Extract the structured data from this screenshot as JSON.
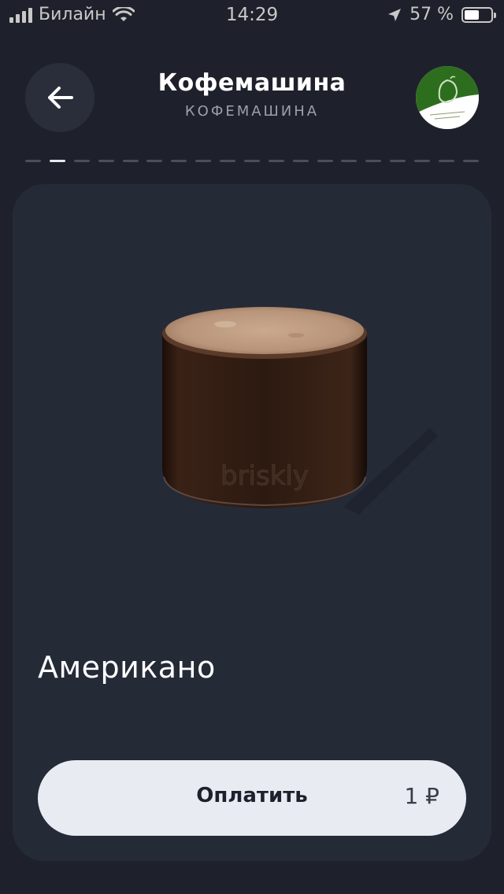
{
  "status_bar": {
    "carrier": "Билайн",
    "time": "14:29",
    "battery": "57 %",
    "battery_level": 0.57
  },
  "header": {
    "title": "Кофемашина",
    "subtitle": "КОФЕМАШИНА",
    "back_icon": "arrow-left-icon",
    "logo_icon": "cafe-logo"
  },
  "pager": {
    "count": 19,
    "active_index": 1
  },
  "product": {
    "name": "Американо",
    "cup_brand": "briskly"
  },
  "pay_button": {
    "label": "Оплатить",
    "price": "1 ₽"
  },
  "colors": {
    "background": "#1e212b",
    "card": "#252a37",
    "button": "#e9ebf2",
    "logo_green": "#2d6e1e"
  }
}
